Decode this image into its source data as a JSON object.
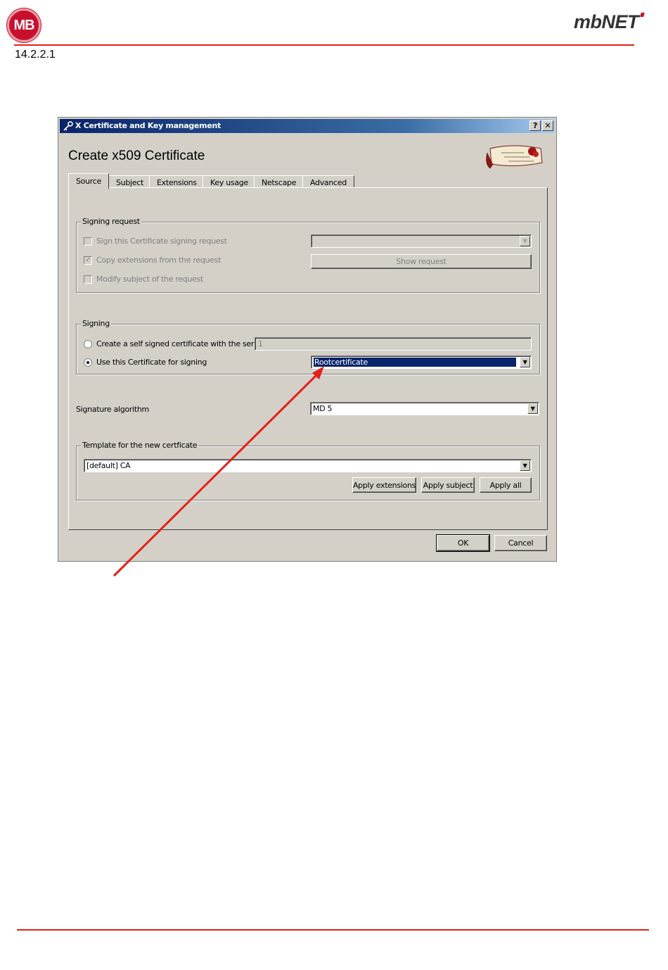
{
  "page": {
    "logo_left_text": "MB",
    "logo_right_text": "mbNET",
    "section_number": "14.2.2.1",
    "accent_color": "#e32119"
  },
  "dialog": {
    "window_title": "X Certificate and Key management",
    "help_button": "?",
    "close_button": "✕",
    "heading": "Create x509 Certificate",
    "tabs": [
      {
        "label": "Source",
        "active": true
      },
      {
        "label": "Subject",
        "active": false
      },
      {
        "label": "Extensions",
        "active": false
      },
      {
        "label": "Key usage",
        "active": false
      },
      {
        "label": "Netscape",
        "active": false
      },
      {
        "label": "Advanced",
        "active": false
      }
    ],
    "signing_request": {
      "legend": "Signing request",
      "sign_csr_label": "Sign this Certificate signing request",
      "sign_csr_checked": false,
      "copy_ext_label": "Copy extensions from the request",
      "copy_ext_checked": true,
      "modify_subject_label": "Modify subject of the request",
      "modify_subject_checked": false,
      "request_select_value": "",
      "show_request_button": "Show request"
    },
    "signing": {
      "legend": "Signing",
      "self_signed_label": "Create a self signed certificate with the serial",
      "serial_value": "1",
      "use_cert_label": "Use this Certificate for signing",
      "selected_option": "use_cert",
      "cert_select_value": "Rootcertificate"
    },
    "signature_algorithm": {
      "label": "Signature algorithm",
      "value": "MD 5"
    },
    "template": {
      "legend": "Template for the new certficate",
      "select_value": "[default] CA",
      "apply_extensions_button": "Apply extensions",
      "apply_subject_button": "Apply subject",
      "apply_all_button": "Apply all"
    },
    "ok_button": "OK",
    "cancel_button": "Cancel"
  },
  "annotation": {
    "arrow_color": "#e32119"
  }
}
